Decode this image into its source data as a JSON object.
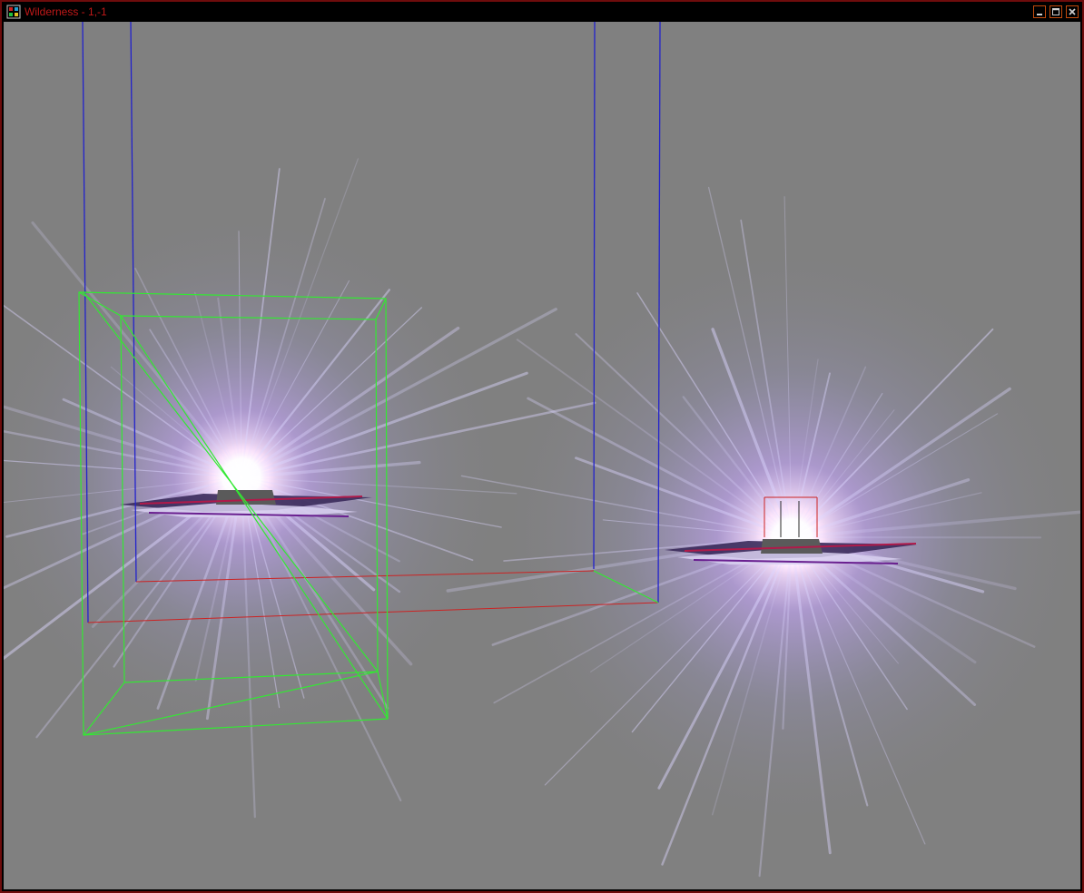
{
  "window": {
    "title": "Wilderness - 1,-1",
    "icon": "editor-grid-icon",
    "controls": [
      "minimize-icon",
      "maximize-icon",
      "close-icon"
    ]
  },
  "scene": {
    "background_color": "#808080",
    "bounding_box_color": "#33e833",
    "axis_colors": {
      "vertical": "#2222cc",
      "horizontal": "#cc2222"
    },
    "flare_colors": {
      "core": "#ffffff",
      "halo": "#c8a8ff",
      "ray": "#dcd6ff"
    },
    "objects": [
      "flare-object-left",
      "flare-object-right"
    ]
  }
}
